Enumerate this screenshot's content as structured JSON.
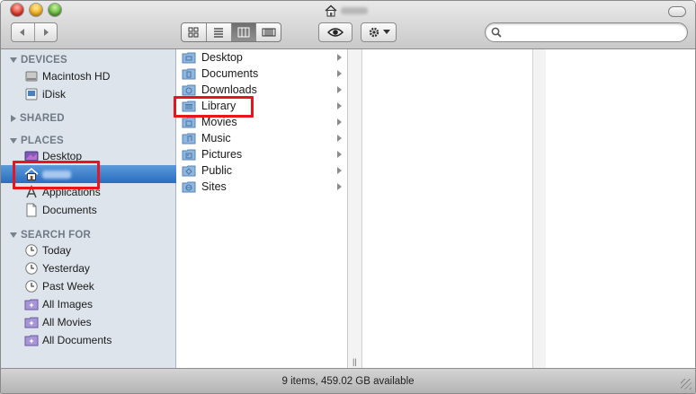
{
  "window": {
    "title_icon": "home-icon"
  },
  "toolbar": {
    "view_modes": [
      "icon-view",
      "list-view",
      "column-view",
      "coverflow-view"
    ],
    "active_view": "column-view",
    "search": {
      "placeholder": "",
      "value": ""
    }
  },
  "sidebar": {
    "sections": {
      "devices": "DEVICES",
      "shared": "SHARED",
      "places": "PLACES",
      "search_for": "SEARCH FOR"
    },
    "devices": [
      {
        "label": "Macintosh HD",
        "icon": "hard-drive-icon"
      },
      {
        "label": "iDisk",
        "icon": "idisk-icon"
      }
    ],
    "places": [
      {
        "label": "Desktop",
        "icon": "desktop-icon"
      },
      {
        "label": "",
        "icon": "home-icon",
        "selected": true
      },
      {
        "label": "Applications",
        "icon": "applications-icon"
      },
      {
        "label": "Documents",
        "icon": "document-icon"
      }
    ],
    "search_for": [
      {
        "label": "Today",
        "icon": "clock-icon"
      },
      {
        "label": "Yesterday",
        "icon": "clock-icon"
      },
      {
        "label": "Past Week",
        "icon": "clock-icon"
      },
      {
        "label": "All Images",
        "icon": "smart-folder-icon"
      },
      {
        "label": "All Movies",
        "icon": "smart-folder-icon"
      },
      {
        "label": "All Documents",
        "icon": "smart-folder-icon"
      }
    ]
  },
  "column1": {
    "items": [
      {
        "label": "Desktop"
      },
      {
        "label": "Documents"
      },
      {
        "label": "Downloads"
      },
      {
        "label": "Library",
        "highlighted": true
      },
      {
        "label": "Movies"
      },
      {
        "label": "Music"
      },
      {
        "label": "Pictures"
      },
      {
        "label": "Public"
      },
      {
        "label": "Sites"
      }
    ]
  },
  "status": {
    "text": "9 items, 459.02 GB available"
  },
  "colors": {
    "selection": "#2a6cc0",
    "sidebar_bg": "#dde4ec",
    "highlight": "#e8161c",
    "folder": "#7aa8d6"
  }
}
